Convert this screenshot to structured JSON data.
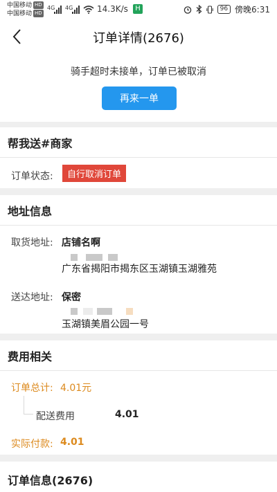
{
  "status_bar": {
    "carrier1": "中国移动",
    "carrier2": "中国移动",
    "hd": "HD",
    "net1": "4G",
    "net2": "4G",
    "speed": "14.3K/s",
    "app_badge": "H",
    "battery": "96",
    "time": "傍晚6:31"
  },
  "nav": {
    "title": "订单详情(2676)"
  },
  "notice": {
    "message": "骑手超时未接单，订单已被取消",
    "button": "再来一单"
  },
  "task": {
    "title": "帮我送#商家",
    "status_label": "订单状态:",
    "status_value": "自行取消订单"
  },
  "address": {
    "title": "地址信息",
    "pickup_label": "取货地址:",
    "pickup_name": "店铺名啊",
    "pickup_addr": "广东省揭阳市揭东区玉湖镇玉湖雅苑",
    "delivery_label": "送达地址:",
    "delivery_name": "保密",
    "delivery_addr": "玉湖镇美眉公园一号"
  },
  "fees": {
    "title": "费用相关",
    "total_label": "订单总计:",
    "total_value": "4.01元",
    "delivery_fee_label": "配送费用",
    "delivery_fee_value": "4.01",
    "paid_label": "实际付款:",
    "paid_value": "4.01"
  },
  "order_info": {
    "title": "订单信息(2676)"
  }
}
